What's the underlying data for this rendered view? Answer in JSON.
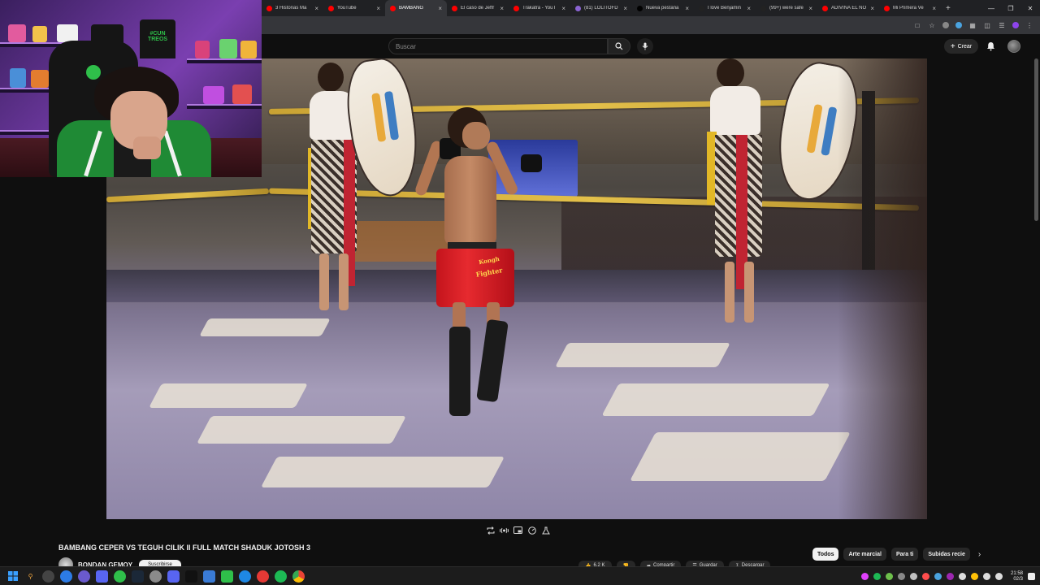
{
  "browser": {
    "tabs": [
      {
        "title": "3 Historias Ma",
        "color": "#ff0000"
      },
      {
        "title": "YouTube",
        "color": "#ff0000"
      },
      {
        "title": "BAMBANG",
        "color": "#ff0000",
        "active": true
      },
      {
        "title": "El caso de Jeffr",
        "color": "#ff0000"
      },
      {
        "title": "Trakatrá - YouT",
        "color": "#ff0000"
      },
      {
        "title": "(81) LOLITOFD",
        "color": "#8a63d2"
      },
      {
        "title": "Nueva pestaña",
        "color": "#000000"
      },
      {
        "title": "I love Benjamin",
        "color": "#222222"
      },
      {
        "title": "(99+) were safe",
        "color": "#222222"
      },
      {
        "title": "ADIVINA EL NO",
        "color": "#ff0000"
      },
      {
        "title": "Mi Primera Ve",
        "color": "#ff0000"
      }
    ],
    "new_tab_glyph": "+"
  },
  "youtube": {
    "search_placeholder": "Buscar",
    "create_label": "Crear",
    "video_title": "BAMBANG CEPER VS TEGUH CILIK II FULL MATCH SHADUK JOTOSH 3",
    "channel_name": "BONDAN GEMOY",
    "subscribe_label": "Suscribirse",
    "actions": [
      {
        "label": "6,2 K",
        "icon": "like-icon"
      },
      {
        "label": "",
        "icon": "dislike-icon"
      },
      {
        "label": "Compartir",
        "icon": "share-icon"
      },
      {
        "label": "Guardar",
        "icon": "save-icon"
      },
      {
        "label": "Descargar",
        "icon": "download-icon"
      }
    ],
    "chips": [
      "Todos",
      "Arte marcial",
      "Para ti",
      "Subidas recie"
    ],
    "overlay": {
      "webcam_shirt_text": "#CUN TREOS"
    },
    "fighter_shorts_text": "Fighter",
    "fighter_shorts_top": "Kongh"
  },
  "taskbar": {
    "clock_time": "21:58",
    "clock_date": "02/3"
  }
}
